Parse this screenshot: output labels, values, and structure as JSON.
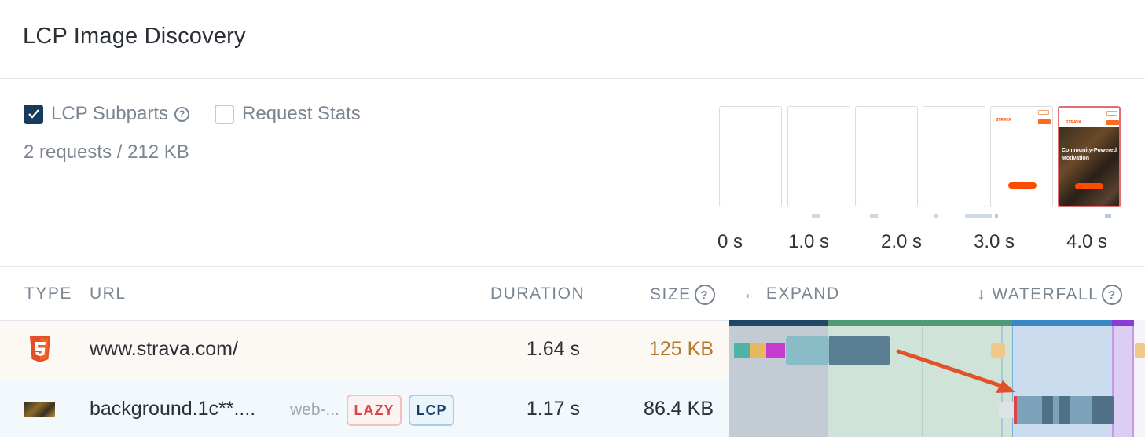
{
  "header": {
    "title": "LCP Image Discovery"
  },
  "controls": {
    "lcp_subparts": {
      "label": "LCP Subparts",
      "checked": true,
      "help_icon": "?"
    },
    "request_stats": {
      "label": "Request Stats",
      "checked": false
    },
    "summary": "2 requests / 212 KB"
  },
  "filmstrip": {
    "time_labels": [
      "0 s",
      "1.0 s",
      "2.0 s",
      "3.0 s",
      "4.0 s"
    ],
    "frame5": {
      "brand": "STRAVA"
    },
    "frame6": {
      "brand": "STRAVA",
      "headline": "Community-Powered Motivation"
    }
  },
  "table": {
    "headers": {
      "type": "TYPE",
      "url": "URL",
      "duration": "DURATION",
      "size": "SIZE",
      "expand": "← EXPAND",
      "waterfall": "↓ WATERFALL",
      "help": "?"
    },
    "rows": [
      {
        "type_icon": "html5-icon",
        "url": "www.strava.com/",
        "duration": "1.64 s",
        "size": "125 KB",
        "size_color": "#b5772a"
      },
      {
        "type_icon": "image-thumbnail",
        "url": "background.1c**....",
        "domain": "web-...",
        "badge_lazy": "LAZY",
        "badge_lcp": "LCP",
        "duration": "1.17 s",
        "size": "86.4 KB"
      }
    ]
  },
  "colors": {
    "accent_dark": "#173b5c",
    "lazy_red": "#d9454b",
    "arrow": "#e0522b"
  }
}
